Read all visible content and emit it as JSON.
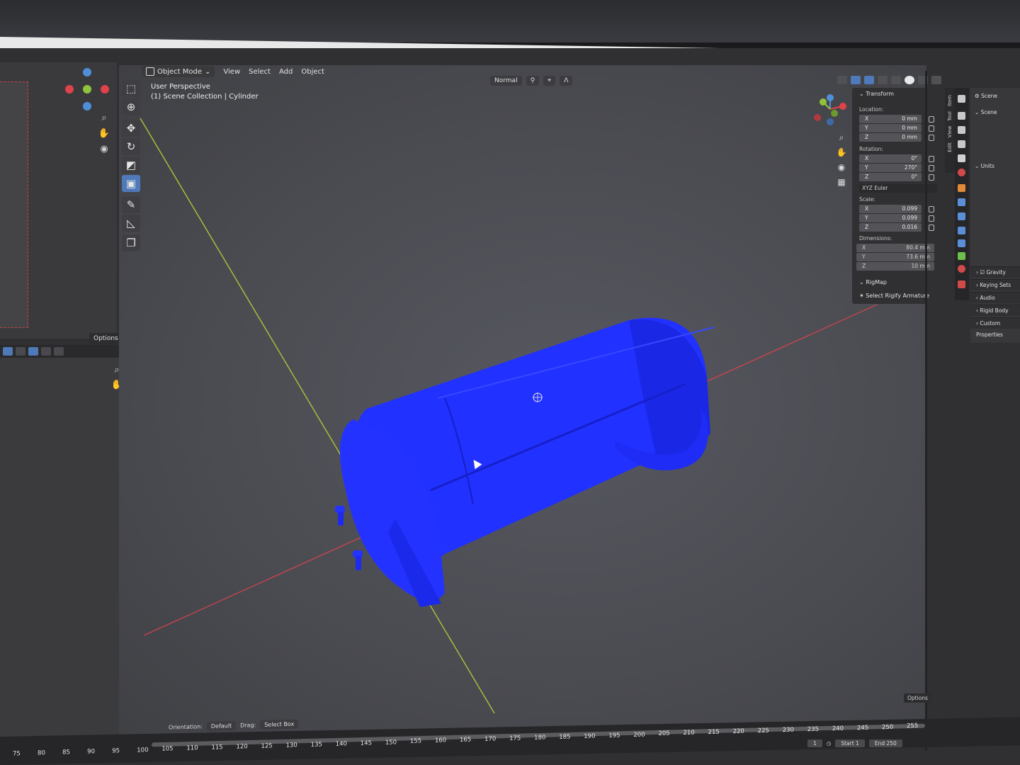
{
  "header": {
    "mode": "Object Mode",
    "menus": [
      "View",
      "Select",
      "Add",
      "Object"
    ],
    "orientation_pill": "Normal"
  },
  "viewport": {
    "perspective": "User Perspective",
    "collection": "(1) Scene Collection | Cylinder"
  },
  "left_panel": {
    "options_label": "Options"
  },
  "transform": {
    "title": "Transform",
    "location_label": "Location:",
    "location": [
      {
        "axis": "X",
        "value": "0 mm"
      },
      {
        "axis": "Y",
        "value": "0 mm"
      },
      {
        "axis": "Z",
        "value": "0 mm"
      }
    ],
    "rotation_label": "Rotation:",
    "rotation": [
      {
        "axis": "X",
        "value": "0°"
      },
      {
        "axis": "Y",
        "value": "270°"
      },
      {
        "axis": "Z",
        "value": "0°"
      }
    ],
    "rotation_mode": "XYZ Euler",
    "scale_label": "Scale:",
    "scale": [
      {
        "axis": "X",
        "value": "0.099"
      },
      {
        "axis": "Y",
        "value": "0.099"
      },
      {
        "axis": "Z",
        "value": "0.016"
      }
    ],
    "dimensions_label": "Dimensions:",
    "dimensions": [
      {
        "axis": "X",
        "value": "80.4 mm"
      },
      {
        "axis": "Y",
        "value": "73.6 mm"
      },
      {
        "axis": "Z",
        "value": "10 mm"
      }
    ],
    "rigmap_title": "RigMap",
    "rigmap_action": "Select Rigify Armature"
  },
  "side_tabs": [
    "Item",
    "Tool",
    "View",
    "Edit"
  ],
  "properties": {
    "scene_title": "Scene",
    "scene_section": "Scene",
    "units": "Units",
    "panels": [
      "Gravity",
      "Keying Sets",
      "Audio",
      "Rigid Body World",
      "Custom Properties"
    ]
  },
  "timeline": {
    "options_label": "Options",
    "orientation_label": "Orientation:",
    "orientation_value": "Default",
    "drag_label": "Drag:",
    "drag_value": "Select Box",
    "ticks": [
      "75",
      "80",
      "85",
      "90",
      "95",
      "100",
      "105",
      "110",
      "115",
      "120",
      "125",
      "130",
      "135",
      "140",
      "145",
      "150",
      "155",
      "160",
      "165",
      "170",
      "175",
      "180",
      "185",
      "190",
      "195",
      "200",
      "205",
      "210",
      "215",
      "220",
      "225",
      "230",
      "235",
      "240",
      "245",
      "250",
      "255"
    ],
    "current_frame": "1",
    "start_label": "Start",
    "start_value": "1",
    "end_label": "End",
    "end_value": "250"
  },
  "colors": {
    "object_blue": "#1f2fff",
    "accent_blue": "#4f79b8",
    "x_axis_red": "#e0424a",
    "y_axis_green": "#8fc43a"
  }
}
